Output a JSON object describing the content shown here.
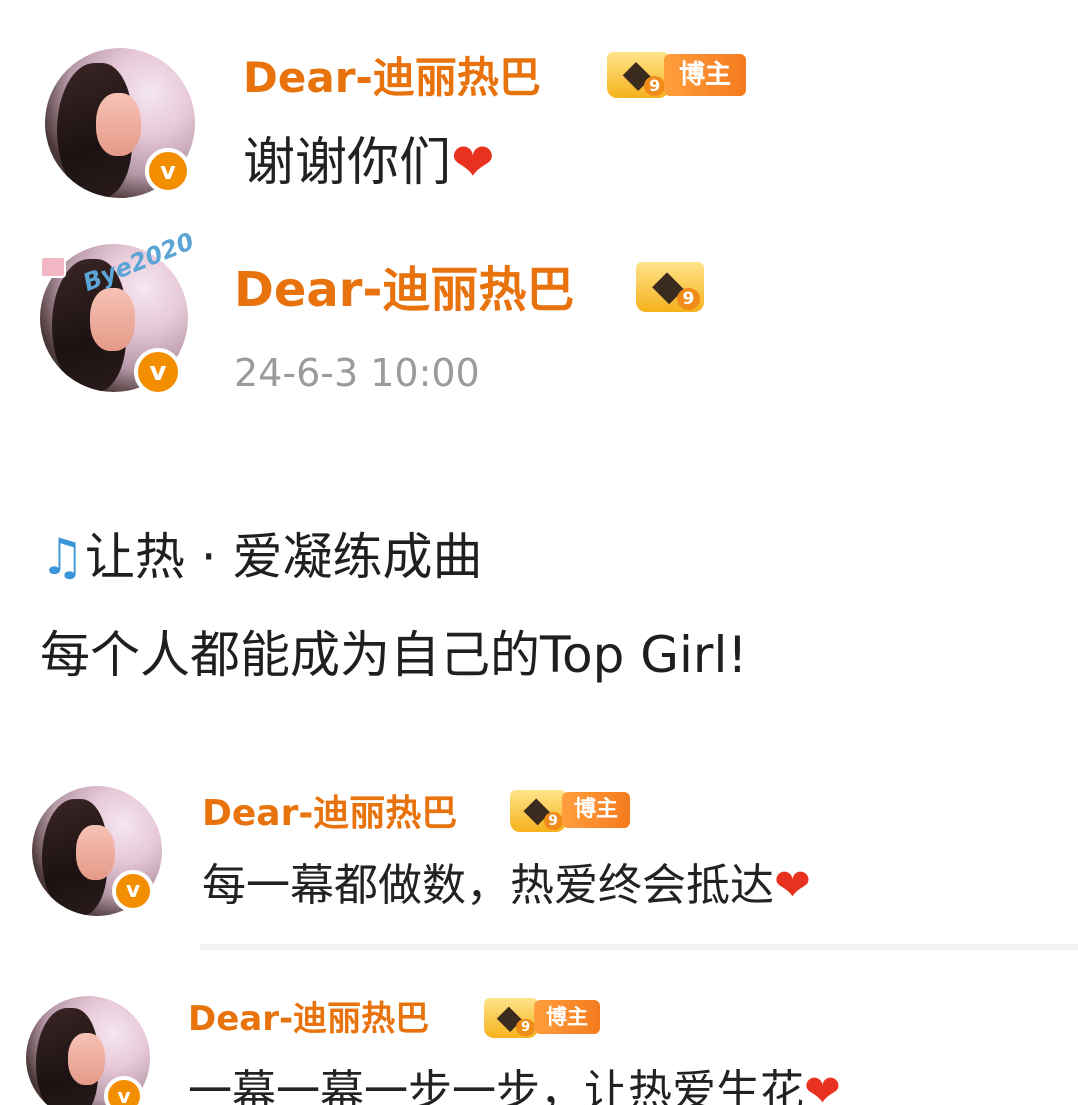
{
  "comment1": {
    "username": "Dear-迪丽热巴",
    "crown_level": "9",
    "tag": "博主",
    "text": "谢谢你们",
    "heart": "❤"
  },
  "post": {
    "username": "Dear-迪丽热巴",
    "crown_level": "9",
    "avatar_decoration": "Bye2020",
    "timestamp": "24-6-3 10:00",
    "line1_icon": "♫",
    "line1": "让热 · 爱凝练成曲",
    "line2": "每个人都能成为自己的Top Girl!"
  },
  "comment2": {
    "username": "Dear-迪丽热巴",
    "crown_level": "9",
    "tag": "博主",
    "text": "每一幕都做数，热爱终会抵达",
    "heart": "❤"
  },
  "comment3": {
    "username": "Dear-迪丽热巴",
    "crown_level": "9",
    "tag": "博主",
    "text": "一幕一幕一步一步，让热爱生花",
    "heart": "❤"
  },
  "colors": {
    "username": "#e8720c",
    "verified_badge": "#f28e00",
    "tag_bg": "#f47b1e",
    "heart": "#e8321f",
    "timestamp": "#9b9b9b",
    "music_note": "#3a96d6"
  },
  "icons": {
    "verified": "verified-badge-icon",
    "crown": "crown-level-icon",
    "heart": "heart-icon",
    "music": "music-note-icon"
  }
}
